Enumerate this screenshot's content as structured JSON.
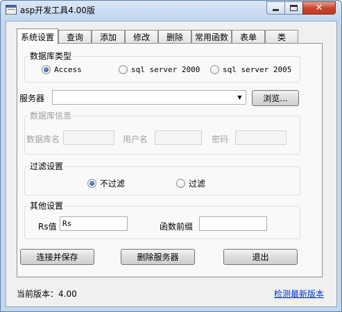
{
  "window": {
    "title": "asp开发工具4.00版",
    "close_glyph": "✕"
  },
  "tabs": [
    {
      "label": "系统设置",
      "active": true
    },
    {
      "label": "查询",
      "active": false
    },
    {
      "label": "添加",
      "active": false
    },
    {
      "label": "修改",
      "active": false
    },
    {
      "label": "删除",
      "active": false
    },
    {
      "label": "常用函数",
      "active": false
    },
    {
      "label": "表单",
      "active": false
    },
    {
      "label": "类",
      "active": false
    }
  ],
  "db_type": {
    "label": "数据库类型",
    "options": [
      {
        "label": "Access",
        "checked": true
      },
      {
        "label": "sql server 2000",
        "checked": false
      },
      {
        "label": "sql server 2005",
        "checked": false
      }
    ]
  },
  "server": {
    "label": "服务器",
    "value": "",
    "browse_label": "浏览..."
  },
  "db_info": {
    "label": "数据库信息",
    "db_name_label": "数据库名",
    "db_name_value": "",
    "user_label": "用户名",
    "user_value": "",
    "password_label": "密码",
    "password_value": ""
  },
  "filter": {
    "label": "过滤设置",
    "options": [
      {
        "label": "不过滤",
        "checked": true
      },
      {
        "label": "过滤",
        "checked": false
      }
    ]
  },
  "other": {
    "label": "其他设置",
    "rs_label": "Rs值",
    "rs_value": "Rs",
    "prefix_label": "函数前缀",
    "prefix_value": ""
  },
  "buttons": {
    "connect_save": "连接并保存",
    "delete_server": "删除服务器",
    "exit": "退出"
  },
  "status": {
    "version_text": "当前版本：4.00",
    "check_update": "检测最新版本"
  }
}
